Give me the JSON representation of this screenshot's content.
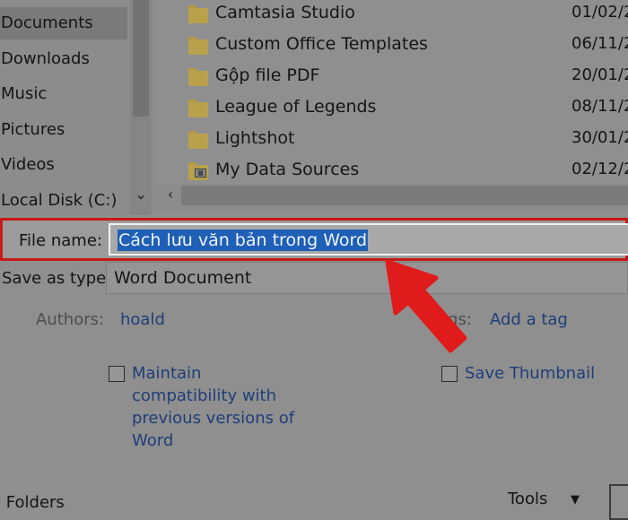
{
  "sidebar": {
    "items": [
      {
        "label": "Documents",
        "selected": true
      },
      {
        "label": "Downloads"
      },
      {
        "label": "Music"
      },
      {
        "label": "Pictures"
      },
      {
        "label": "Videos"
      },
      {
        "label": "Local Disk (C:)"
      }
    ],
    "scroll_down_icon": "chevron-down-icon"
  },
  "files": [
    {
      "name": "Camtasia Studio",
      "date": "01/02/2",
      "icon": "folder-icon"
    },
    {
      "name": "Custom Office Templates",
      "date": "06/11/2",
      "icon": "folder-icon"
    },
    {
      "name": "Gộp file PDF",
      "date": "20/01/2",
      "icon": "folder-icon"
    },
    {
      "name": "League of Legends",
      "date": "08/11/2",
      "icon": "folder-icon"
    },
    {
      "name": "Lightshot",
      "date": "30/01/2",
      "icon": "folder-icon"
    },
    {
      "name": "My Data Sources",
      "date": "02/12/2",
      "icon": "data-sources-folder-icon"
    }
  ],
  "file_name": {
    "label": "File name:",
    "value": "Cách lưu văn bản trong Word"
  },
  "save_as_type": {
    "label": "Save as type:",
    "value": "Word Document"
  },
  "authors": {
    "label": "Authors:",
    "value": "hoald"
  },
  "tags": {
    "label": "Tags:",
    "visible_label": "ags:",
    "value": "Add a tag"
  },
  "options": {
    "maintain_compat": {
      "label": "Maintain compatibility with previous versions of Word",
      "checked": false
    },
    "save_thumbnail": {
      "label": "Save Thumbnail",
      "checked": false
    }
  },
  "footer": {
    "hide_folders": "Hide Folders",
    "hide_folders_visible": "e Folders",
    "tools": "Tools"
  },
  "colors": {
    "highlight_border": "#c81818",
    "annotation_arrow": "#e01b1b",
    "selection": "#1f5fb5",
    "link": "#1d3f78"
  }
}
